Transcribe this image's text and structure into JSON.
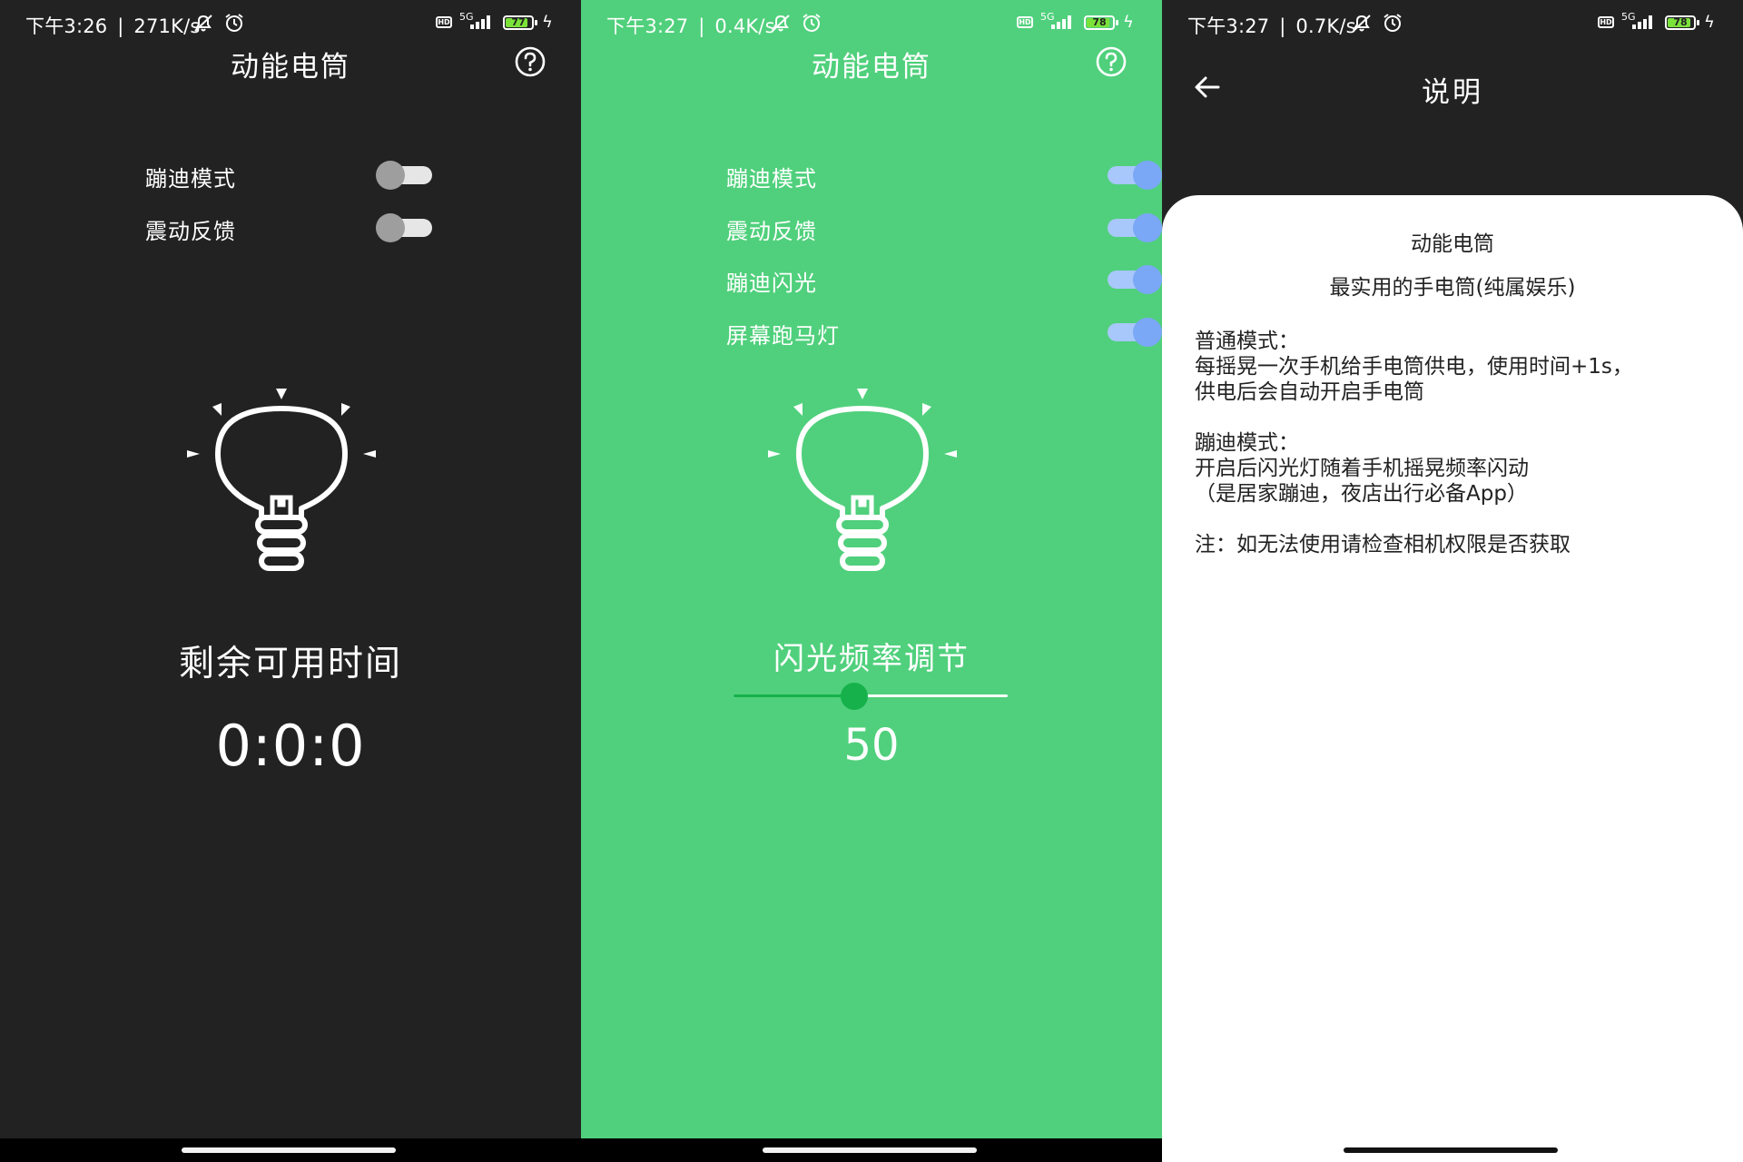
{
  "screens": [
    {
      "status": {
        "time": "下午3:26",
        "speed": "271K/s",
        "battery": "77"
      },
      "title": "动能电筒",
      "toggles": [
        {
          "label": "蹦迪模式",
          "on": false
        },
        {
          "label": "震动反馈",
          "on": false
        }
      ],
      "remaining_label": "剩余可用时间",
      "timer": "0:0:0"
    },
    {
      "status": {
        "time": "下午3:27",
        "speed": "0.4K/s",
        "battery": "78"
      },
      "title": "动能电筒",
      "toggles": [
        {
          "label": "蹦迪模式",
          "on": true
        },
        {
          "label": "震动反馈",
          "on": true
        },
        {
          "label": "蹦迪闪光",
          "on": true
        },
        {
          "label": "屏幕跑马灯",
          "on": true
        }
      ],
      "slider_label": "闪光频率调节",
      "slider_value": "50",
      "slider_fraction": 0.44
    },
    {
      "status": {
        "time": "下午3:27",
        "speed": "0.7K/s",
        "battery": "78"
      },
      "title": "说明",
      "sheet": {
        "app_name": "动能电筒",
        "tagline": "最实用的手电筒(纯属娱乐)",
        "normal_mode_heading": "普通模式：",
        "normal_mode_line1": "每摇晃一次手机给手电筒供电，使用时间+1s，",
        "normal_mode_line2": "供电后会自动开启手电筒",
        "disco_mode_heading": "蹦迪模式：",
        "disco_mode_line1": "开启后闪光灯随着手机摇晃频率闪动",
        "disco_mode_line2": "（是居家蹦迪，夜店出行必备App）",
        "note": "注：如无法使用请检查相机权限是否获取"
      }
    }
  ],
  "status_common": {
    "hd": "HD",
    "network": "5G",
    "separator": "|"
  },
  "colors": {
    "dark_bg": "#222222",
    "green_bg": "#50D07C",
    "switch_on_track": "#a8c7fa",
    "switch_on_knob": "#7aa7f6",
    "slider_accent": "#16B14A",
    "battery_fill": "#7BE23A"
  },
  "icons": [
    "help-icon",
    "back-arrow-icon",
    "lightbulb-icon",
    "alarm-icon",
    "mute-bell-icon",
    "signal-icon",
    "battery-icon",
    "charging-bolt-icon"
  ]
}
